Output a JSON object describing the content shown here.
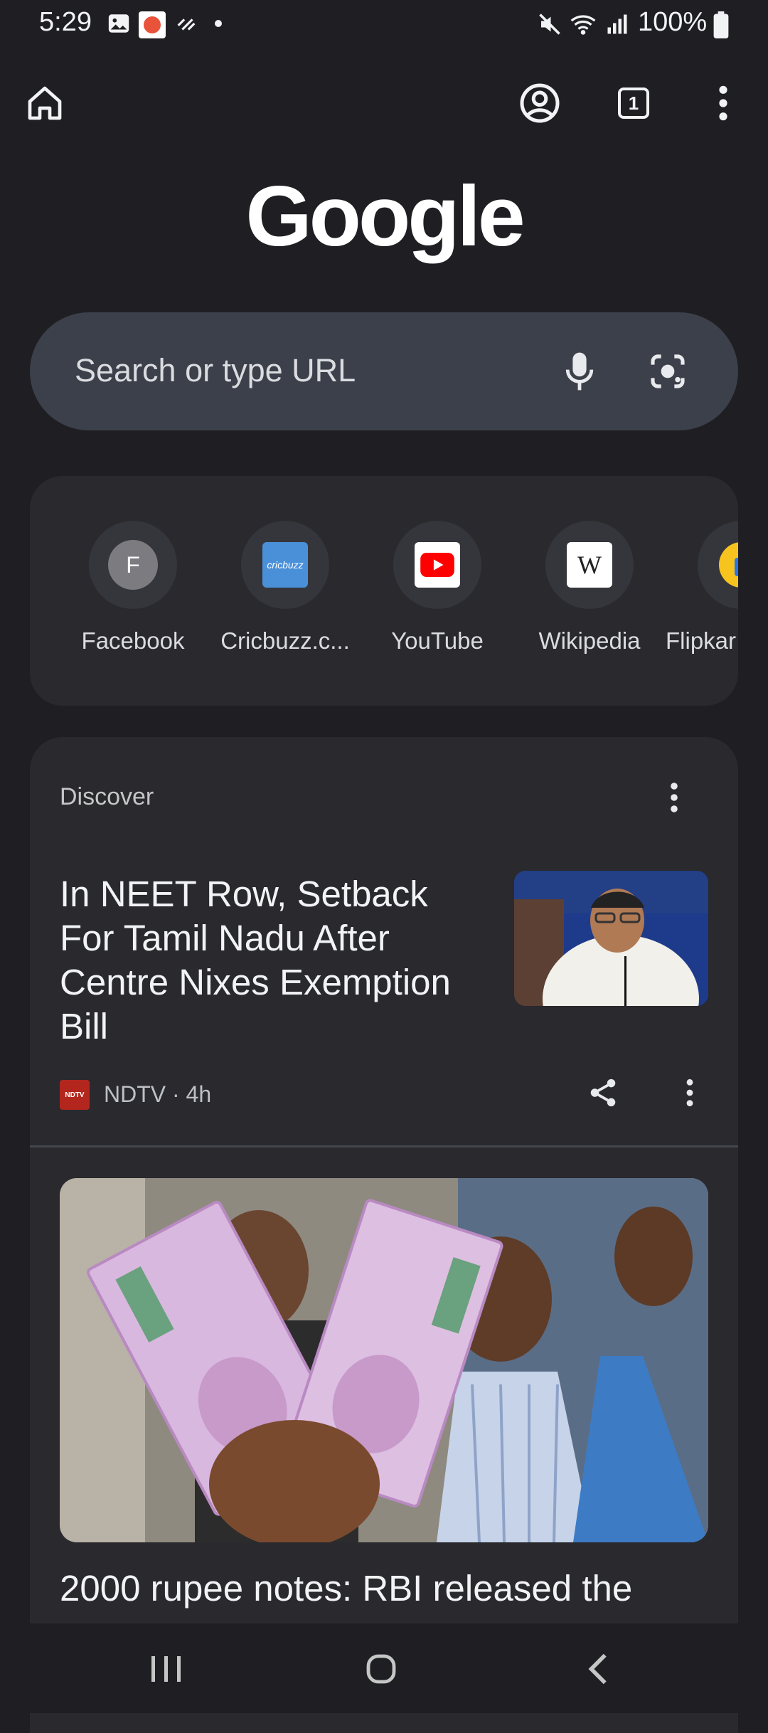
{
  "status": {
    "time": "5:29",
    "battery": "100%"
  },
  "search": {
    "placeholder": "Search or type URL"
  },
  "logo_text": "Google",
  "shortcuts": [
    {
      "label": "Facebook",
      "letter": "F"
    },
    {
      "label": "Cricbuzz.c...",
      "logo_text": "cricbuzz"
    },
    {
      "label": "YouTube"
    },
    {
      "label": "Wikipedia",
      "logo_text": "W"
    },
    {
      "label": "Flipkar"
    }
  ],
  "tab_count": "1",
  "discover": {
    "title": "Discover",
    "articles": [
      {
        "headline": "In NEET Row, Setback For Tamil Nadu After Centre Nixes Exemption Bill",
        "source": "NDTV · 4h",
        "source_logo_text": "NDTV"
      },
      {
        "headline": "2000 rupee notes: RBI released the"
      }
    ]
  },
  "colors": {
    "background": "#1f1f23",
    "card": "#29292e",
    "search_bar": "#3c404a"
  }
}
